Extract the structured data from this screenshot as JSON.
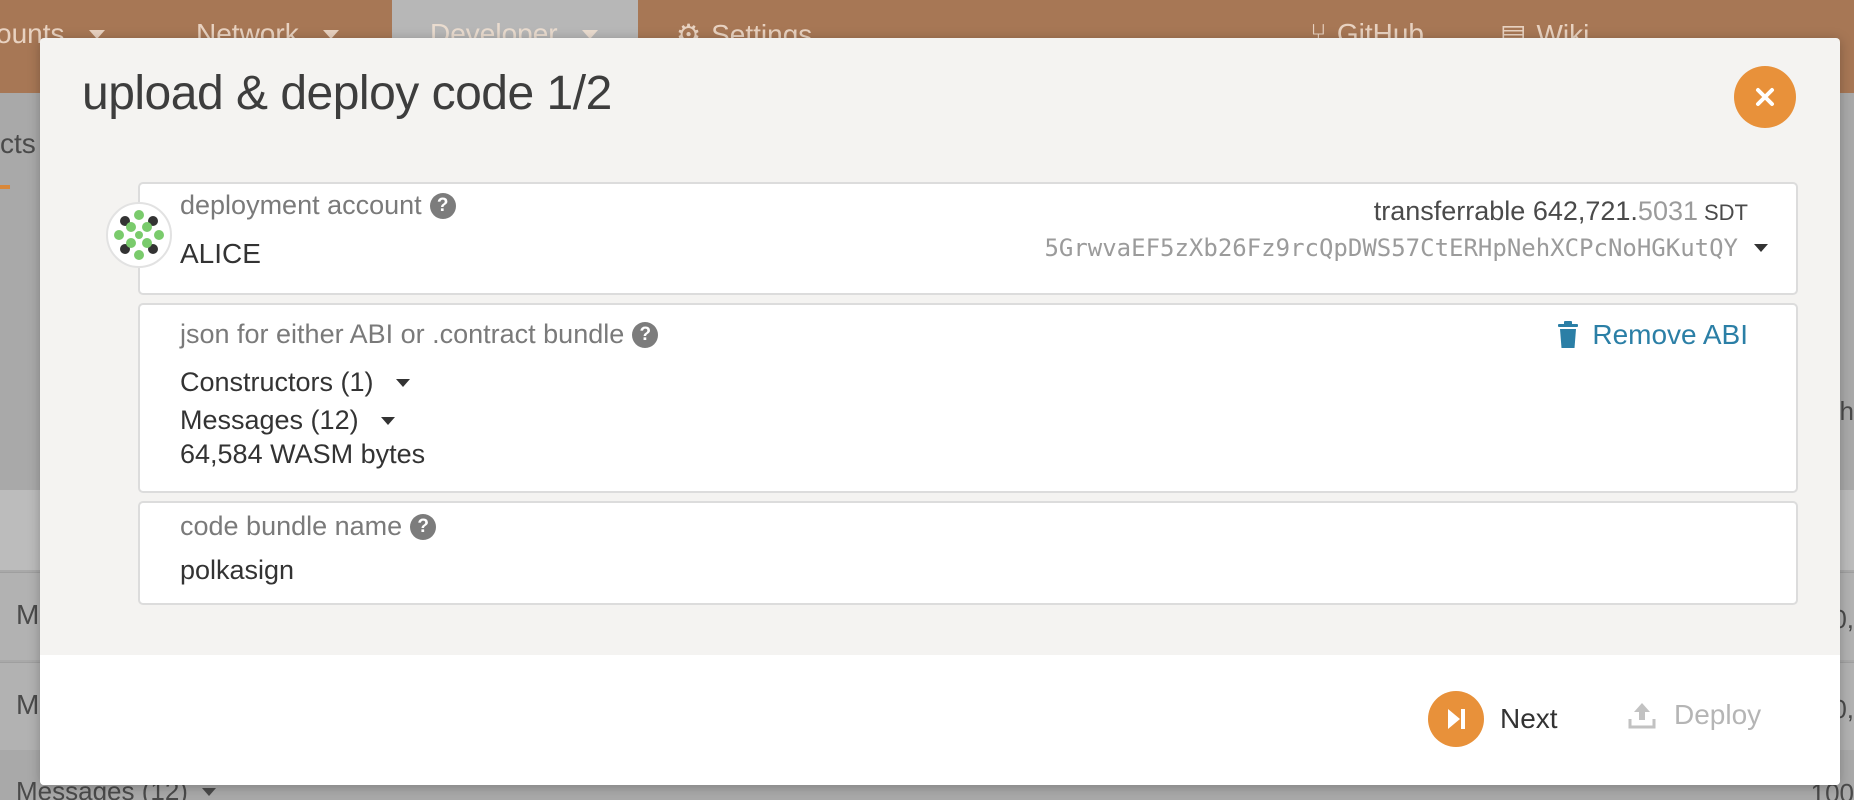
{
  "background": {
    "nav": {
      "accounts": "ounts",
      "network": "Network",
      "developer": "Developer",
      "settings": "Settings",
      "github": "GitHub",
      "wiki": "Wiki"
    },
    "tab_fragment": "cts",
    "row1_fragment": "M",
    "row2_fragment": "M",
    "bottom_text": "Messages (12)",
    "right_frag_1": "h",
    "right_frag_2": "0,",
    "right_frag_3": "0,",
    "right_frag_4": "100"
  },
  "modal": {
    "title": "upload & deploy code 1/2",
    "account": {
      "label": "deployment account",
      "name": "ALICE",
      "balance_label": "transferrable",
      "balance_int": "642,721.",
      "balance_dec": "5031",
      "balance_unit": "SDT",
      "address": "5GrwvaEF5zXb26Fz9rcQpDWS57CtERHpNehXCPcNoHGKutQY"
    },
    "abi": {
      "label": "json for either ABI or .contract bundle",
      "remove_label": "Remove ABI",
      "constructors": "Constructors (1)",
      "messages": "Messages (12)",
      "wasm_bytes": "64,584 WASM bytes"
    },
    "bundle": {
      "label": "code bundle name",
      "value": "polkasign"
    },
    "buttons": {
      "next": "Next",
      "deploy": "Deploy"
    }
  },
  "colors": {
    "accent": "#e8913a",
    "link": "#2b7fa6",
    "topbar": "#a77755"
  }
}
